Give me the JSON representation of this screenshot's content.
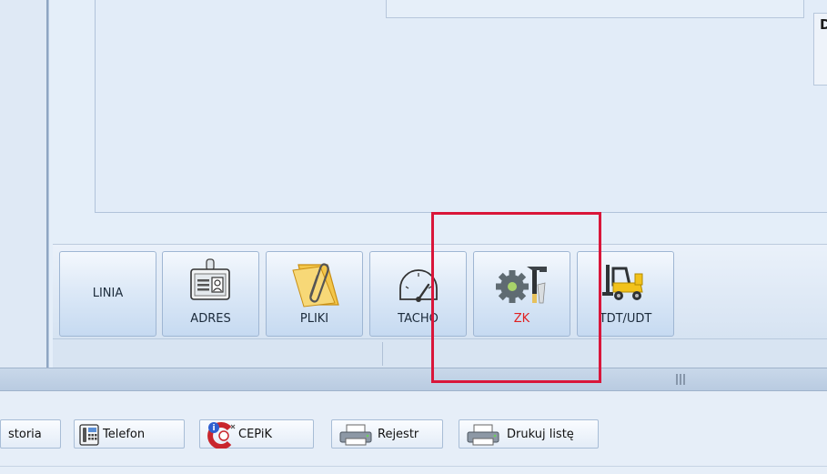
{
  "panel": {
    "right_letter": "D"
  },
  "toolbar": {
    "linia": "LINIA",
    "adres": "ADRES",
    "pliki": "PLIKI",
    "tacho": "TACHO",
    "zk": "ZK",
    "tdt_udt": "TDT/UDT",
    "zk_color": "#e02020"
  },
  "bottom": {
    "historia": "storia",
    "telefon": "Telefon",
    "cepik": "CEPiK",
    "rejestr": "Rejestr",
    "drukuj": "Drukuj listę"
  },
  "highlight": {
    "color": "#d9163a"
  }
}
